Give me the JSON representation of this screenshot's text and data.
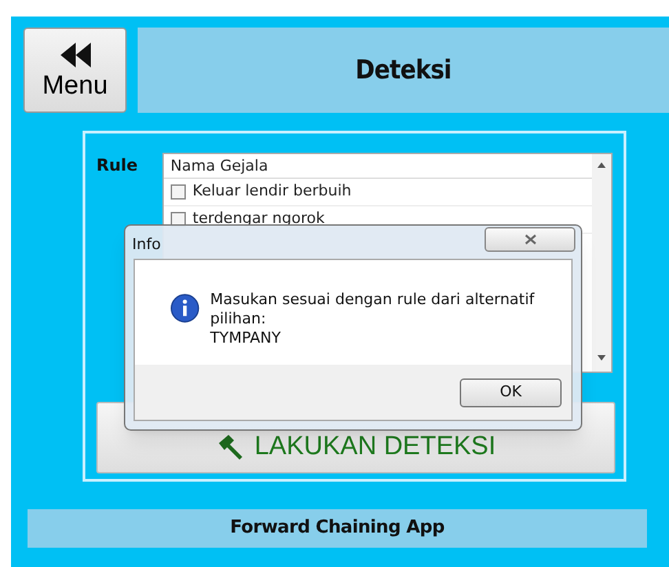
{
  "header": {
    "menu_button": "Menu",
    "title": "Deteksi"
  },
  "rule": {
    "label": "Rule",
    "column": "Nama Gejala",
    "items": [
      {
        "label": "Keluar lendir berbuih",
        "checked": false
      },
      {
        "label": "terdengar ngorok",
        "checked": false
      }
    ]
  },
  "action_button": "LAKUKAN DETEKSI",
  "dialog": {
    "title": "Info",
    "message": "Masukan sesuai dengan rule dari alternatif pilihan:",
    "result": "TYMPANY",
    "ok": "OK"
  },
  "footer": "Forward Chaining App"
}
